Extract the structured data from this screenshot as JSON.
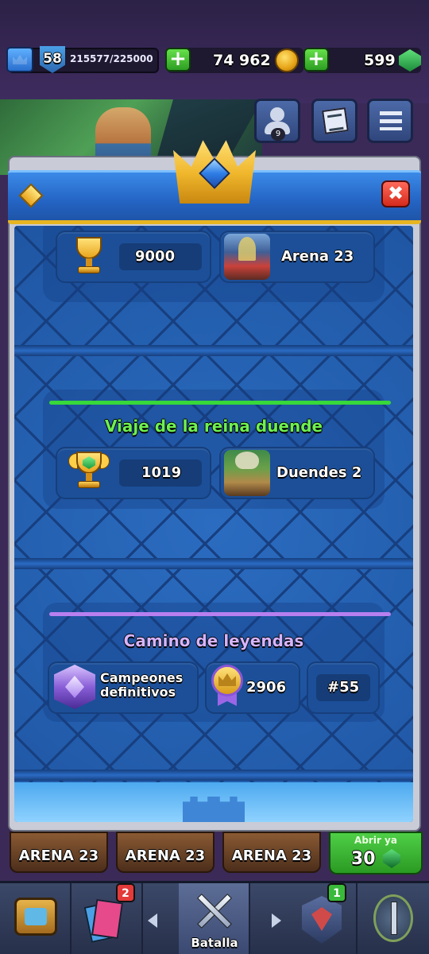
{
  "status_bar": {
    "level": "58",
    "xp": "215577/225000",
    "gold": "74 962",
    "gems": "599",
    "plus_symbol": "+"
  },
  "side_buttons": {
    "friends_count": "9"
  },
  "modal": {
    "close_symbol": "✖",
    "trophy_road": {
      "trophies": "9000",
      "arena": "Arena 23"
    },
    "goblin_queen": {
      "title": "Viaje de la reina duende",
      "trophies": "1019",
      "arena": "Duendes 2",
      "accent_color": "#37d83a"
    },
    "path_of_legends": {
      "title": "Camino de leyendas",
      "league": "Campeones definitivos",
      "rating": "2906",
      "rank": "#55",
      "accent_color": "#b77ff0"
    }
  },
  "arena_tabs": [
    "ARENA 23",
    "ARENA 23",
    "ARENA 23"
  ],
  "open_chest": {
    "label": "Abrir ya",
    "cost": "30"
  },
  "bottom_nav": {
    "cards_badge": "2",
    "battle_label": "Batalla",
    "clan_badge": "1"
  },
  "colors": {
    "modal_blue": "#225aa8",
    "header_gold": "#e7b522",
    "close_red": "#d42a1c"
  }
}
